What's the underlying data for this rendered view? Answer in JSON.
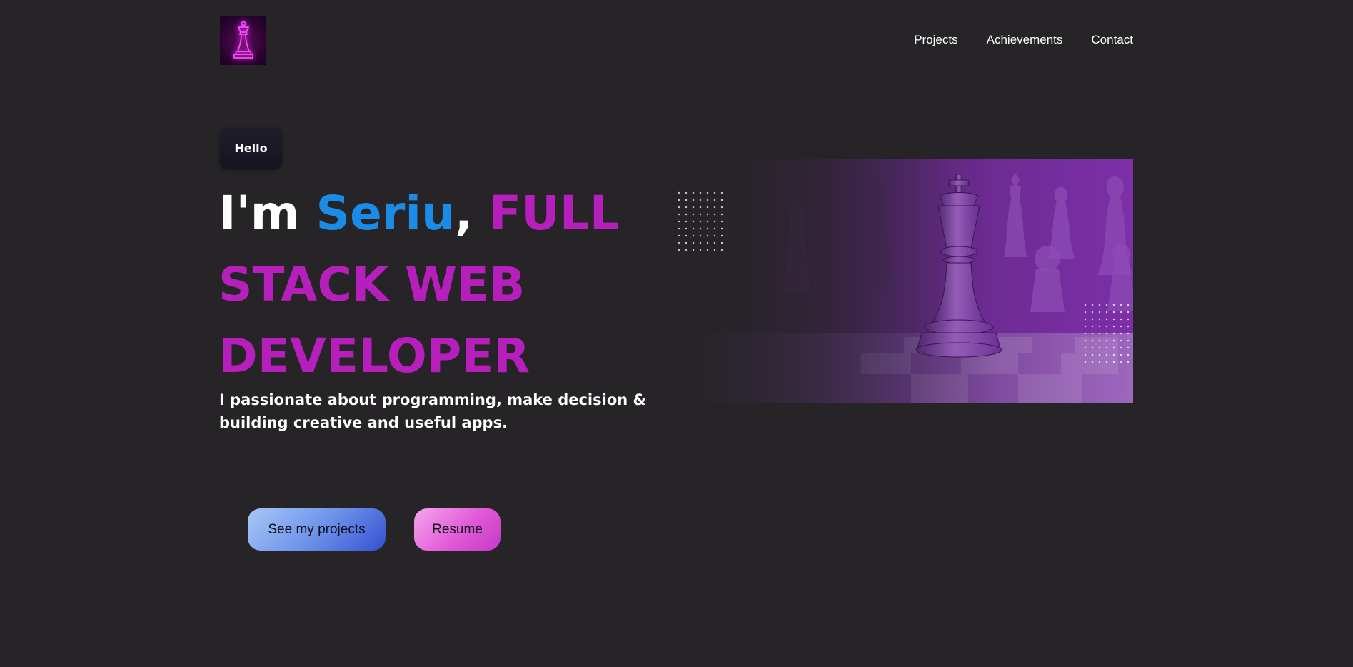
{
  "header": {
    "logo_icon": "chess-queen-neon-icon",
    "nav": [
      {
        "label": "Projects"
      },
      {
        "label": "Achievements"
      },
      {
        "label": "Contact"
      }
    ]
  },
  "hero": {
    "badge": "Hello",
    "headline": {
      "part1": "I'm ",
      "name": "Seriu",
      "comma": ", ",
      "role": "FULL STACK WEB DEVELOPER"
    },
    "subtitle": "I passionate about programming, make decision & building creative and useful apps.",
    "buttons": {
      "projects": "See my projects",
      "resume": "Resume"
    },
    "image_icon": "chess-king-image"
  },
  "colors": {
    "background": "#262427",
    "name_blue": "#1b8be8",
    "role_magenta": "#b71fbd",
    "image_purple": "#7d2fa8"
  }
}
